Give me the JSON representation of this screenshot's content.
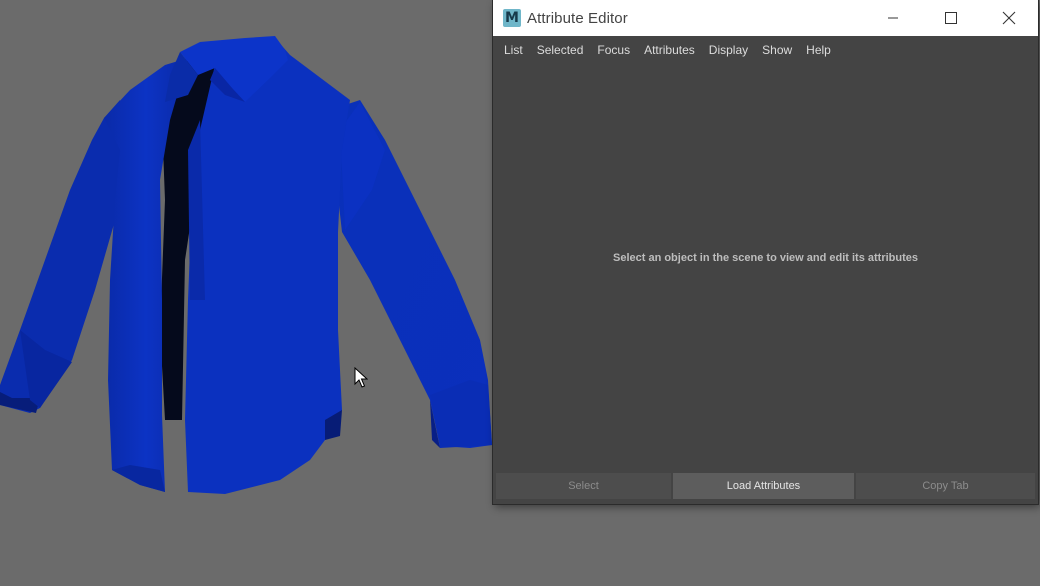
{
  "window": {
    "title": "Attribute Editor",
    "icon_letter": "M"
  },
  "menu": [
    "List",
    "Selected",
    "Focus",
    "Attributes",
    "Display",
    "Show",
    "Help"
  ],
  "content": {
    "empty_message": "Select an object in the scene to view and edit its attributes"
  },
  "buttons": {
    "select": "Select",
    "load_attributes": "Load Attributes",
    "copy_tab": "Copy Tab"
  },
  "colors": {
    "viewport_bg": "#6b6b6b",
    "shirt_blue": "#0a2fb8",
    "panel_bg": "#444444"
  }
}
